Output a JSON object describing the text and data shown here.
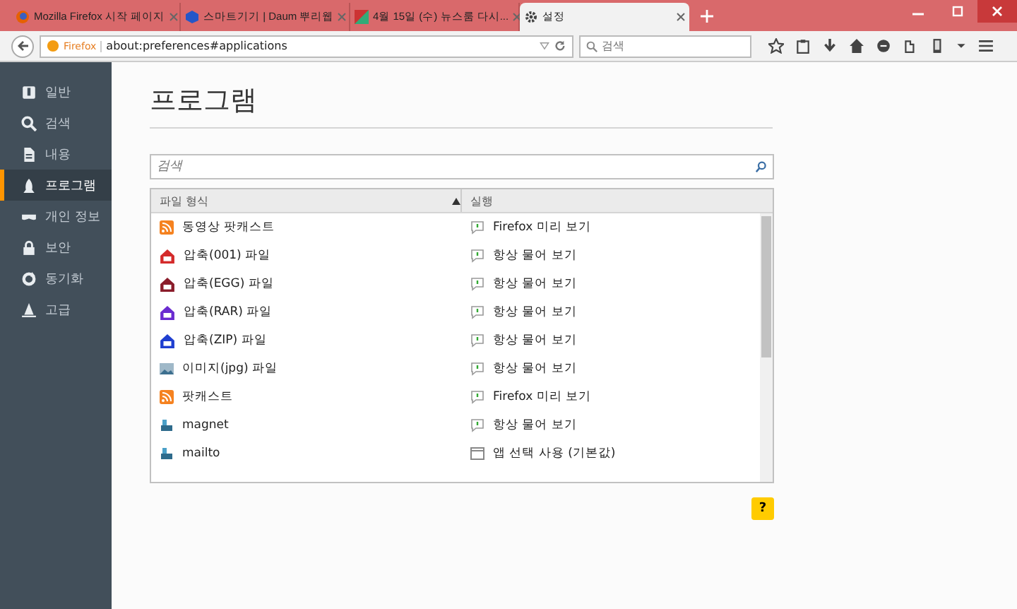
{
  "tabs": [
    {
      "title": "Mozilla Firefox 시작 페이지",
      "selected": false
    },
    {
      "title": "스마트기기 | Daum 뿌리웹",
      "selected": false
    },
    {
      "title": "4월 15일 (수) 뉴스룸 다시...",
      "selected": false
    },
    {
      "title": "설정",
      "selected": true
    }
  ],
  "address_bar": {
    "identity": "Firefox",
    "url": "about:preferences#applications"
  },
  "search_bar": {
    "placeholder": "검색"
  },
  "sidebar": {
    "items": [
      {
        "label": "일반",
        "selected": false
      },
      {
        "label": "검색",
        "selected": false
      },
      {
        "label": "내용",
        "selected": false
      },
      {
        "label": "프로그램",
        "selected": true
      },
      {
        "label": "개인 정보",
        "selected": false
      },
      {
        "label": "보안",
        "selected": false
      },
      {
        "label": "동기화",
        "selected": false
      },
      {
        "label": "고급",
        "selected": false
      }
    ]
  },
  "page_title": "프로그램",
  "filter": {
    "placeholder": "검색"
  },
  "table": {
    "columns": [
      "파일 형식",
      "실행"
    ],
    "rows": [
      {
        "type": "동영상 팟캐스트",
        "kind": "feed",
        "action": {
          "text": "Firefox 미리 보기",
          "kind": "bubble"
        }
      },
      {
        "type": "압축(001) 파일",
        "kind": "archive",
        "color": "#d42a2a",
        "action": {
          "text": "항상 물어 보기",
          "kind": "bubble"
        }
      },
      {
        "type": "압축(EGG) 파일",
        "kind": "archive",
        "color": "#8a1c2a",
        "action": {
          "text": "항상 물어 보기",
          "kind": "bubble"
        }
      },
      {
        "type": "압축(RAR) 파일",
        "kind": "archive",
        "color": "#6a2bd0",
        "action": {
          "text": "항상 물어 보기",
          "kind": "bubble"
        }
      },
      {
        "type": "압축(ZIP) 파일",
        "kind": "archive",
        "color": "#1f3fd0",
        "action": {
          "text": "항상 물어 보기",
          "kind": "bubble"
        }
      },
      {
        "type": "이미지(jpg) 파일",
        "kind": "image",
        "action": {
          "text": "항상 물어 보기",
          "kind": "bubble"
        }
      },
      {
        "type": "팟캐스트",
        "kind": "feed",
        "action": {
          "text": "Firefox 미리 보기",
          "kind": "bubble"
        }
      },
      {
        "type": "magnet",
        "kind": "app",
        "action": {
          "text": "항상 물어 보기",
          "kind": "bubble"
        }
      },
      {
        "type": "mailto",
        "kind": "app",
        "action": {
          "text": "앱 선택 사용 (기본값)",
          "kind": "window"
        }
      }
    ]
  },
  "help_button": "?"
}
